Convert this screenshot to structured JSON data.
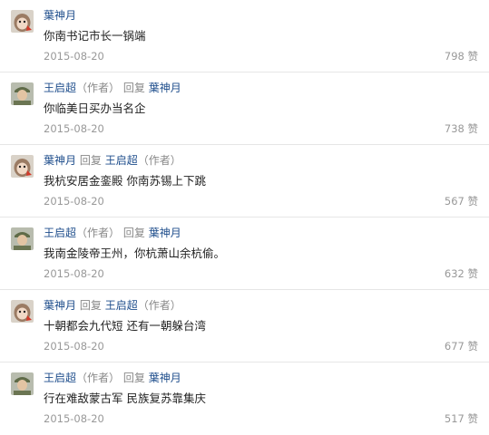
{
  "comments": [
    {
      "author": "葉神月",
      "avatar": "monkey-avatar",
      "author_note": "",
      "reply_label": "",
      "reply_to": "",
      "reply_to_note": "",
      "text": "你南书记市长一锅端",
      "date": "2015-08-20",
      "likes": "798",
      "like_label": "赞"
    },
    {
      "author": "王启超",
      "avatar": "soldier-avatar",
      "author_note": "（作者）",
      "reply_label": "回复",
      "reply_to": "葉神月",
      "reply_to_note": "",
      "text": "你临美日买办当名企",
      "date": "2015-08-20",
      "likes": "738",
      "like_label": "赞"
    },
    {
      "author": "葉神月",
      "avatar": "monkey-avatar",
      "author_note": "",
      "reply_label": "回复",
      "reply_to": "王启超",
      "reply_to_note": "（作者）",
      "text": "我杭安居金銮殿 你南苏锡上下跳",
      "date": "2015-08-20",
      "likes": "567",
      "like_label": "赞"
    },
    {
      "author": "王启超",
      "avatar": "soldier-avatar",
      "author_note": "（作者）",
      "reply_label": "回复",
      "reply_to": "葉神月",
      "reply_to_note": "",
      "text": "我南金陵帝王州，你杭萧山余杭偷。",
      "date": "2015-08-20",
      "likes": "632",
      "like_label": "赞"
    },
    {
      "author": "葉神月",
      "avatar": "monkey-avatar",
      "author_note": "",
      "reply_label": "回复",
      "reply_to": "王启超",
      "reply_to_note": "（作者）",
      "text": "十朝都会九代短 还有一朝躲台湾",
      "date": "2015-08-20",
      "likes": "677",
      "like_label": "赞"
    },
    {
      "author": "王启超",
      "avatar": "soldier-avatar",
      "author_note": "（作者）",
      "reply_label": "回复",
      "reply_to": "葉神月",
      "reply_to_note": "",
      "text": "行在难敌蒙古军 民族复苏靠集庆",
      "date": "2015-08-20",
      "likes": "517",
      "like_label": "赞"
    }
  ],
  "colors": {
    "name": "#1f4e8c",
    "muted": "#999999",
    "divider": "#e6e6e6"
  }
}
